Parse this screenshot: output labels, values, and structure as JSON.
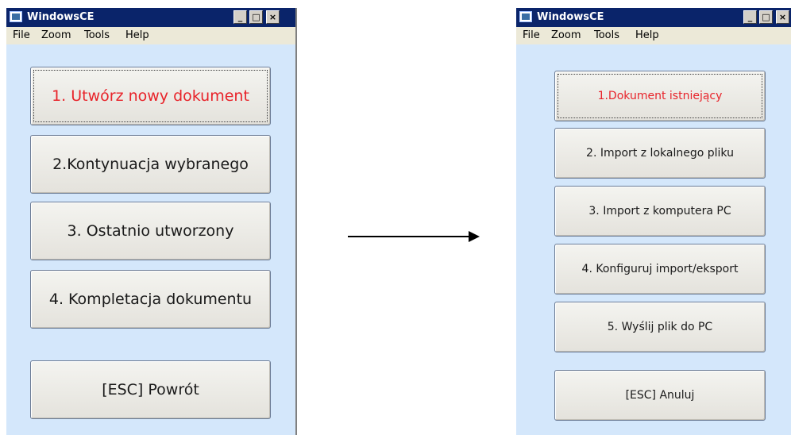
{
  "left_window": {
    "title": "WindowsCE",
    "menu": [
      "File",
      "Zoom",
      "Tools",
      "Help"
    ],
    "controls": [
      "_",
      "□",
      "×"
    ],
    "buttons": [
      "1. Utwórz  nowy dokument",
      "2.Kontynuacja wybranego",
      "3. Ostatnio utworzony",
      "4. Kompletacja dokumentu",
      "[ESC] Powrót"
    ]
  },
  "right_window": {
    "title": "WindowsCE",
    "menu": [
      "File",
      "Zoom",
      "Tools",
      "Help"
    ],
    "controls": [
      "_",
      "□",
      "×"
    ],
    "buttons": [
      "1.Dokument istniejący",
      "2. Import z lokalnego pliku",
      "3. Import z komputera PC",
      "4. Konfiguruj import/eksport",
      "5. Wyślij plik do PC",
      "[ESC] Anuluj"
    ]
  },
  "colors": {
    "window_bg": "#d4e7fb",
    "titlebar": "#0a246a",
    "highlight_text": "#e8232a"
  }
}
